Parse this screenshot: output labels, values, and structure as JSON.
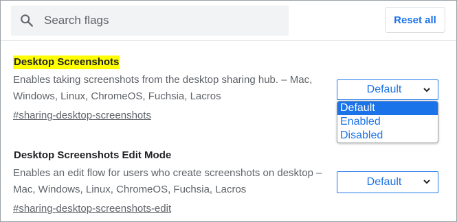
{
  "search": {
    "placeholder": "Search flags"
  },
  "header": {
    "reset_label": "Reset all"
  },
  "flags": [
    {
      "title": "Desktop Screenshots",
      "highlighted": true,
      "description": "Enables taking screenshots from the desktop sharing hub. – Mac, Windows, Linux, ChromeOS, Fuchsia, Lacros",
      "link": "#sharing-desktop-screenshots",
      "select_value": "Default",
      "dropdown_open": true,
      "options": [
        "Default",
        "Enabled",
        "Disabled"
      ]
    },
    {
      "title": "Desktop Screenshots Edit Mode",
      "highlighted": false,
      "description": "Enables an edit flow for users who create screenshots on desktop – Mac, Windows, Linux, ChromeOS, Fuchsia, Lacros",
      "link": "#sharing-desktop-screenshots-edit",
      "select_value": "Default",
      "dropdown_open": false
    }
  ],
  "colors": {
    "accent": "#1a73e8",
    "highlight": "#ffff00",
    "text": "#202124",
    "muted": "#5f6368"
  },
  "icons": {
    "search": "search-icon",
    "chevron": "chevron-down-icon"
  }
}
